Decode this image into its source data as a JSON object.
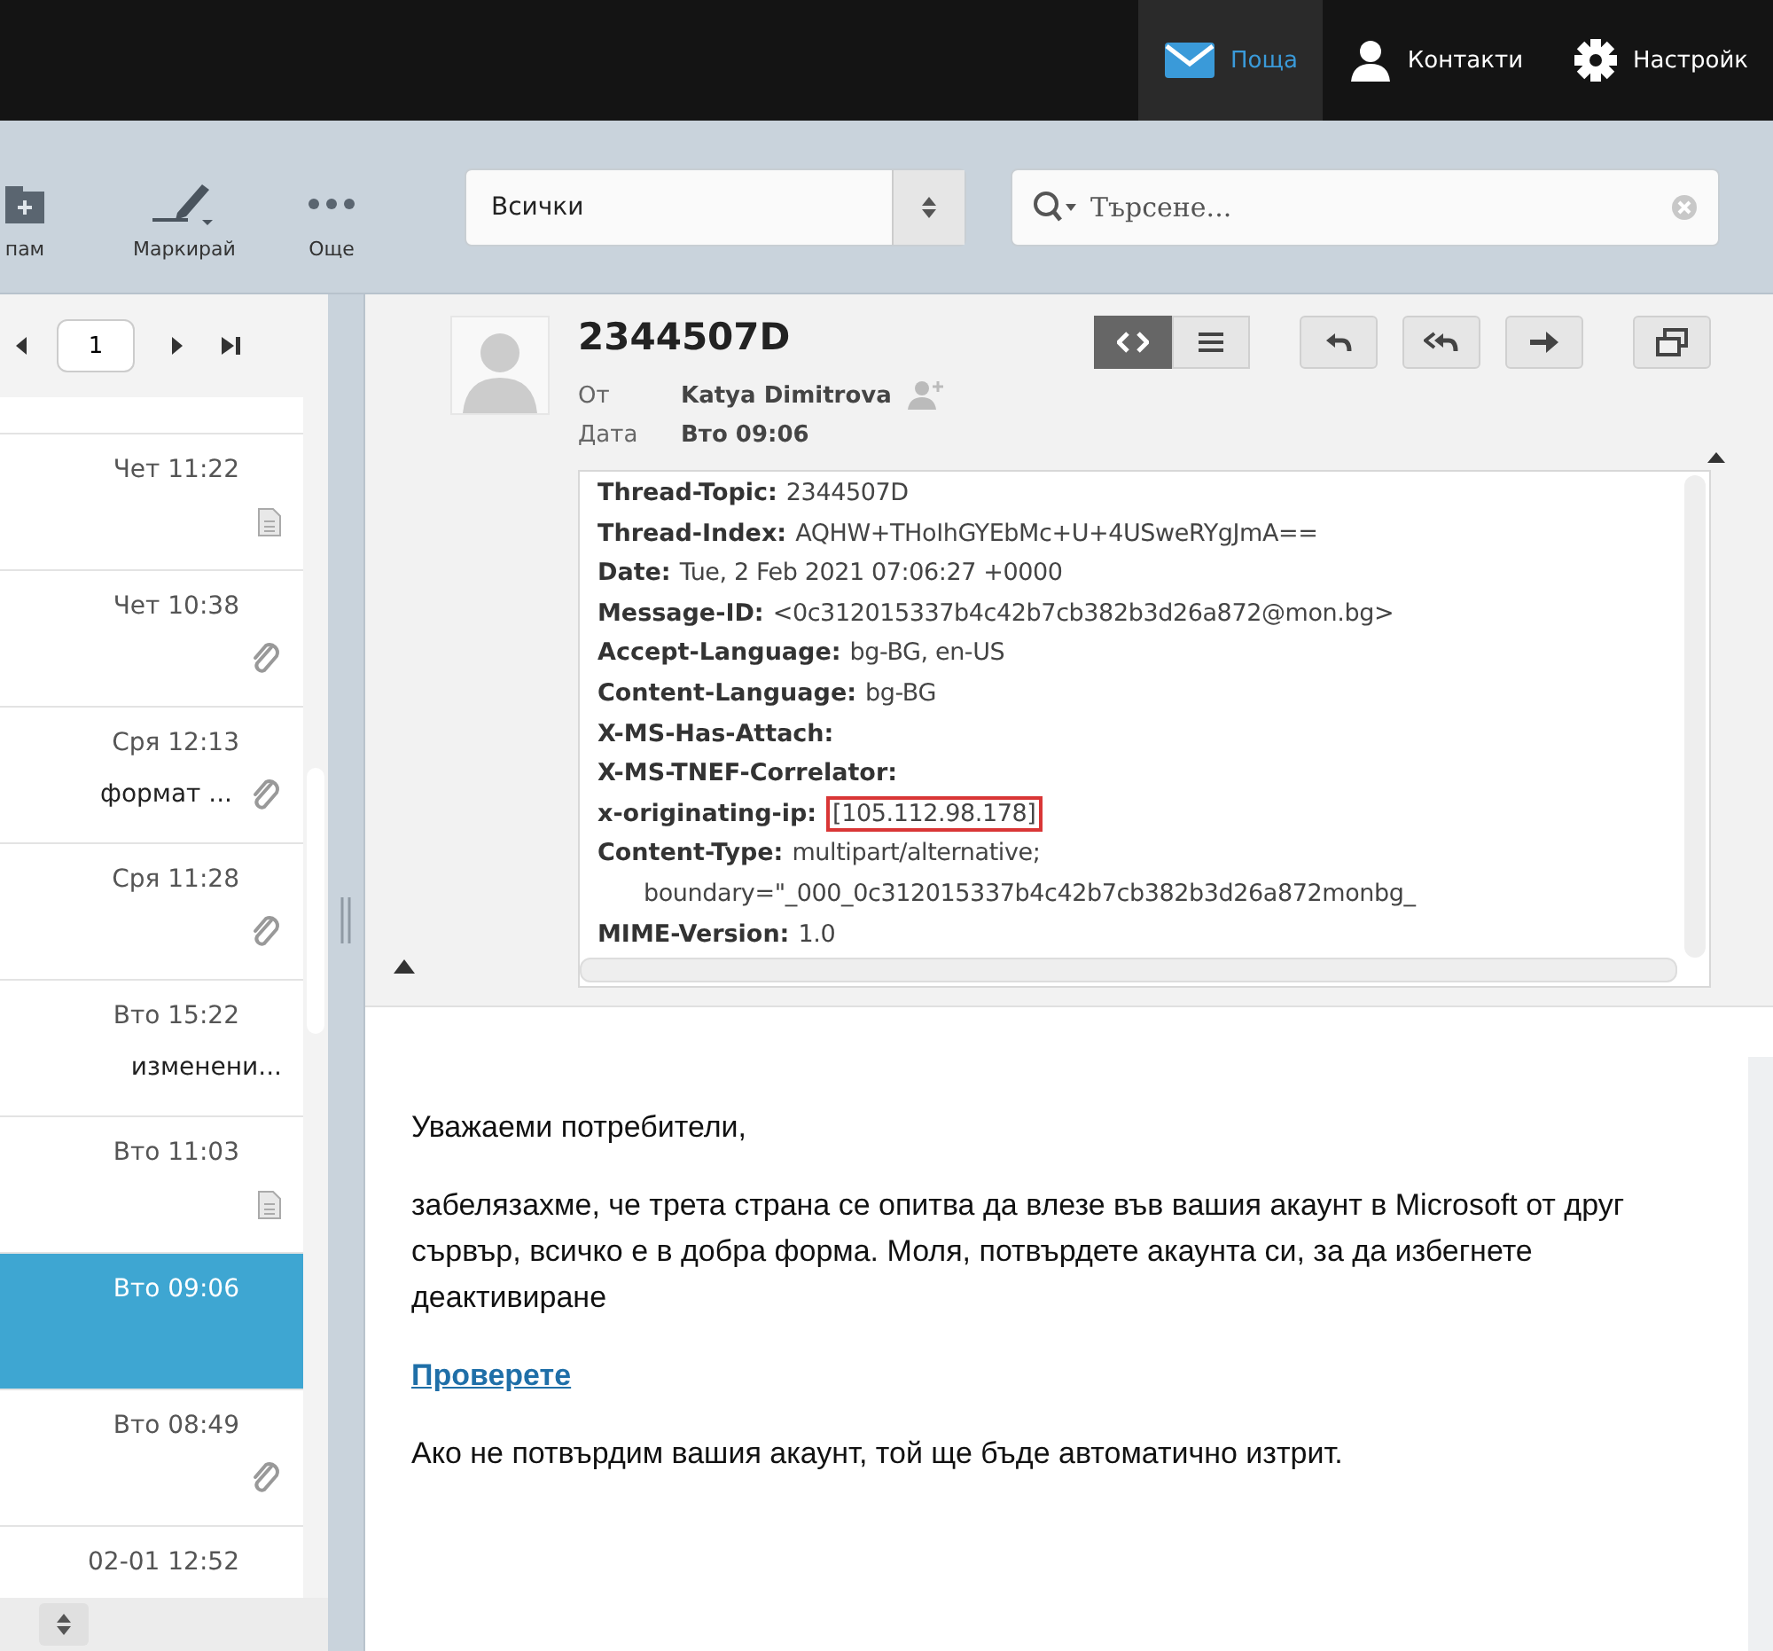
{
  "nav": [
    {
      "label": "Поща",
      "kind": "mail",
      "selected": true
    },
    {
      "label": "Контакти",
      "kind": "contacts",
      "selected": false
    },
    {
      "label": "Настройк",
      "kind": "settings",
      "selected": false
    }
  ],
  "toolbar": [
    {
      "label": "пам",
      "kind": "spam"
    },
    {
      "label": "Маркирай",
      "kind": "mark"
    },
    {
      "label": "Още",
      "kind": "more"
    }
  ],
  "filter": {
    "value": "Всички"
  },
  "search": {
    "placeholder": "Търсене..."
  },
  "pager": {
    "page": "1"
  },
  "messages": [
    {
      "time": "Чет 11:22",
      "kind": "document",
      "selected": false
    },
    {
      "time": "Чет 10:38",
      "kind": "attachment",
      "selected": false
    },
    {
      "time": "Сря 12:13",
      "subject": "формат ...",
      "kind": "attachment",
      "selected": false
    },
    {
      "time": "Сря 11:28",
      "kind": "attachment",
      "selected": false
    },
    {
      "time": "Вто 15:22",
      "subject": "изменени...",
      "kind": "plain",
      "selected": false
    },
    {
      "time": "Вто 11:03",
      "kind": "document",
      "selected": false
    },
    {
      "time": "Вто 09:06",
      "kind": "plain",
      "selected": true
    },
    {
      "time": "Вто 08:49",
      "kind": "attachment",
      "selected": false
    },
    {
      "time": "02-01 12:52",
      "kind": "plain",
      "selected": false
    }
  ],
  "message": {
    "subject": "2344507D",
    "from_label": "От",
    "from": "Katya Dimitrova",
    "date_label": "Дата",
    "date": "Вто 09:06",
    "headers": [
      {
        "kind": "field",
        "name": "Thread-Topic:",
        "value": "2344507D"
      },
      {
        "kind": "field",
        "name": "Thread-Index:",
        "value": "AQHW+THoIhGYEbMc+U+4USweRYgJmA=="
      },
      {
        "kind": "field",
        "name": "Date:",
        "value": "Tue, 2 Feb 2021 07:06:27 +0000"
      },
      {
        "kind": "field",
        "name": "Message-ID:",
        "value": "<0c312015337b4c42b7cb382b3d26a872@mon.bg>"
      },
      {
        "kind": "field",
        "name": "Accept-Language:",
        "value": "bg-BG, en-US"
      },
      {
        "kind": "field",
        "name": "Content-Language:",
        "value": "bg-BG"
      },
      {
        "kind": "field",
        "name": "X-MS-Has-Attach:"
      },
      {
        "kind": "field",
        "name": "X-MS-TNEF-Correlator:"
      },
      {
        "kind": "highlighted",
        "name": "x-originating-ip:",
        "value": "[105.112.98.178]"
      },
      {
        "kind": "field",
        "name": "Content-Type:",
        "value": "multipart/alternative;"
      },
      {
        "kind": "continuation",
        "value": "boundary=\"_000_0c312015337b4c42b7cb382b3d26a872monbg_"
      },
      {
        "kind": "field",
        "name": "MIME-Version:",
        "value": "1.0"
      }
    ],
    "body": [
      {
        "kind": "text",
        "text": "Уважаеми потребители,"
      },
      {
        "kind": "text",
        "text": "забелязахме, че трета страна се опитва да влезе във вашия акаунт в Microsoft от друг сървър, всичко е в добра форма. Моля, потвърдете акаунта си, за да избегнете деактивиране"
      },
      {
        "kind": "link",
        "text": "Проверете"
      },
      {
        "kind": "text",
        "text": "Ако не потвърдим вашия акаунт, той ще бъде автоматично изтрит."
      }
    ]
  }
}
